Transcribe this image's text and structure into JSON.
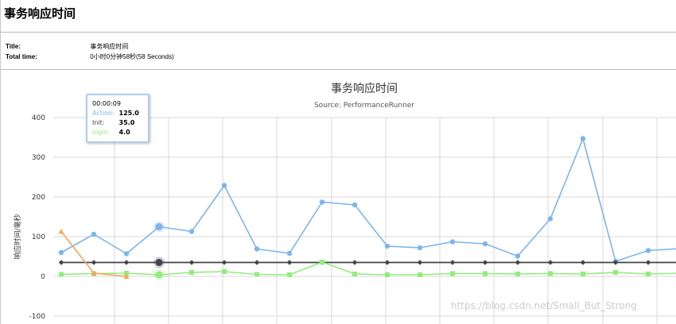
{
  "page": {
    "title": "事务响应时间"
  },
  "info": {
    "title_label": "Title:",
    "title_value": "事务响应时间",
    "total_label": "Total time:",
    "total_value": "0小时0分钟58秒(58 Seconds)"
  },
  "chart_data": {
    "type": "line",
    "title": "事务响应时间",
    "subtitle": "Source: PerformanceRunner",
    "ylabel": "响应时间/毫秒",
    "ylim": [
      -100,
      400
    ],
    "yticks": [
      -100,
      0,
      100,
      200,
      300,
      400
    ],
    "grid": true,
    "colors": {
      "Action": "#7cb5ec",
      "Init": "#434348",
      "login": "#90ed7d",
      "orange": "#f7a35c"
    },
    "series": [
      {
        "name": "Action",
        "color": "#7cb5ec",
        "marker": "circle",
        "values": [
          60,
          106,
          57,
          125,
          113,
          229,
          69,
          58,
          187,
          180,
          76,
          72,
          87,
          82,
          51,
          145,
          347,
          38,
          65,
          70
        ]
      },
      {
        "name": "Init",
        "color": "#434348",
        "marker": "diamond",
        "values": [
          35,
          35,
          35,
          35,
          35,
          35,
          35,
          35,
          35,
          35,
          35,
          35,
          35,
          35,
          35,
          35,
          35,
          35,
          35,
          35
        ]
      },
      {
        "name": "login",
        "color": "#90ed7d",
        "marker": "square",
        "values": [
          5,
          7,
          8,
          4,
          10,
          12,
          5,
          4,
          36,
          6,
          4,
          4,
          7,
          7,
          6,
          7,
          6,
          10,
          6,
          8
        ]
      },
      {
        "name": "",
        "color": "#f7a35c",
        "marker": "triangle",
        "values": [
          113,
          8,
          0,
          null,
          null,
          null,
          null,
          null,
          null,
          null,
          null,
          null,
          null,
          null,
          null,
          null,
          null,
          null,
          null,
          null
        ]
      }
    ]
  },
  "tooltip": {
    "time": "00:00:09",
    "rows": [
      {
        "series": "Action:",
        "value": "125.0",
        "color": "#7cb5ec"
      },
      {
        "series": "Init:",
        "value": "35.0",
        "color": "#434348"
      },
      {
        "series": "login:",
        "value": "4.0",
        "color": "#90ed7d"
      }
    ]
  },
  "watermark": "https://blog.csdn.net/Small_But_Strong"
}
